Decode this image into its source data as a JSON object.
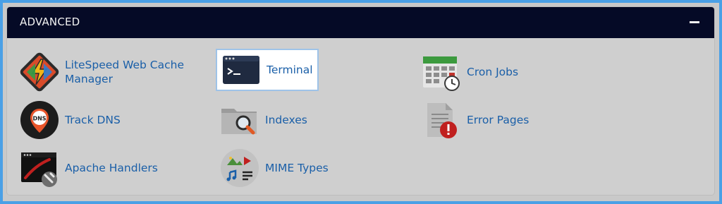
{
  "panel": {
    "title": "ADVANCED",
    "collapse_icon": "minus-icon"
  },
  "items": [
    {
      "id": "litespeed",
      "label": "LiteSpeed Web Cache Manager",
      "icon": "litespeed-icon"
    },
    {
      "id": "terminal",
      "label": "Terminal",
      "icon": "terminal-icon",
      "highlighted": true
    },
    {
      "id": "cron",
      "label": "Cron Jobs",
      "icon": "calendar-clock-icon"
    },
    {
      "id": "trackdns",
      "label": "Track DNS",
      "icon": "dns-pin-icon",
      "badge": "DNS"
    },
    {
      "id": "indexes",
      "label": "Indexes",
      "icon": "folder-search-icon"
    },
    {
      "id": "errorpages",
      "label": "Error Pages",
      "icon": "document-error-icon"
    },
    {
      "id": "apache",
      "label": "Apache Handlers",
      "icon": "window-wrench-icon"
    },
    {
      "id": "mime",
      "label": "MIME Types",
      "icon": "media-types-icon"
    }
  ],
  "colors": {
    "header_bg": "#050a26",
    "link": "#1a5fa8",
    "panel_bg": "#cfcfcf",
    "border": "#4aa0e6"
  }
}
